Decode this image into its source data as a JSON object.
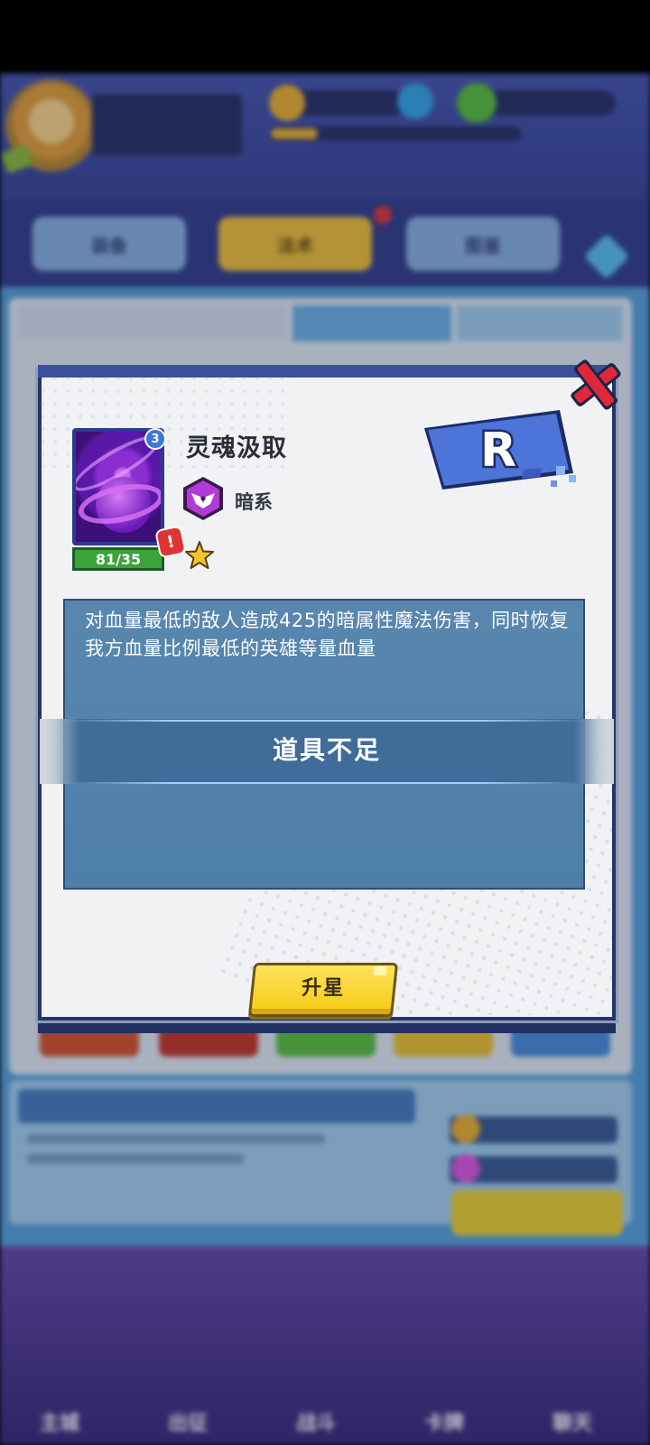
{
  "modal": {
    "skill_name": "灵魂汲取",
    "skill_level": "3",
    "card_count": "81/35",
    "element": "暗系",
    "rarity": "R",
    "description": "对血量最低的敌人造成425的暗属性魔法伤害，同时恢复我方血量比例最低的英雄等量血量",
    "toast": "道具不足",
    "upstar_button": "升星"
  },
  "background_tabs": [
    {
      "label": "装备"
    },
    {
      "label": "法术"
    },
    {
      "label": "图鉴"
    }
  ],
  "navbar": [
    {
      "label": "主城",
      "color": "#5b7a3a"
    },
    {
      "label": "出征",
      "color": "#4a56a8"
    },
    {
      "label": "战斗",
      "color": "#4a4488"
    },
    {
      "label": "卡牌",
      "color": "#3f5cb5"
    },
    {
      "label": "聊天",
      "color": "#3b5aa8"
    }
  ],
  "colors": {
    "modal_bg": "#f1f2f4",
    "desc_bg": "#4e7fa9",
    "button_yellow": "#f4cb14",
    "rarity_blue": "#4d74d8",
    "count_green": "#3aa43a",
    "element_purple": "#8a2ea8"
  },
  "icons": {
    "close": "close-x-icon",
    "element": "dark-element-icon",
    "star": "star-icon",
    "alert": "exclamation-icon"
  }
}
